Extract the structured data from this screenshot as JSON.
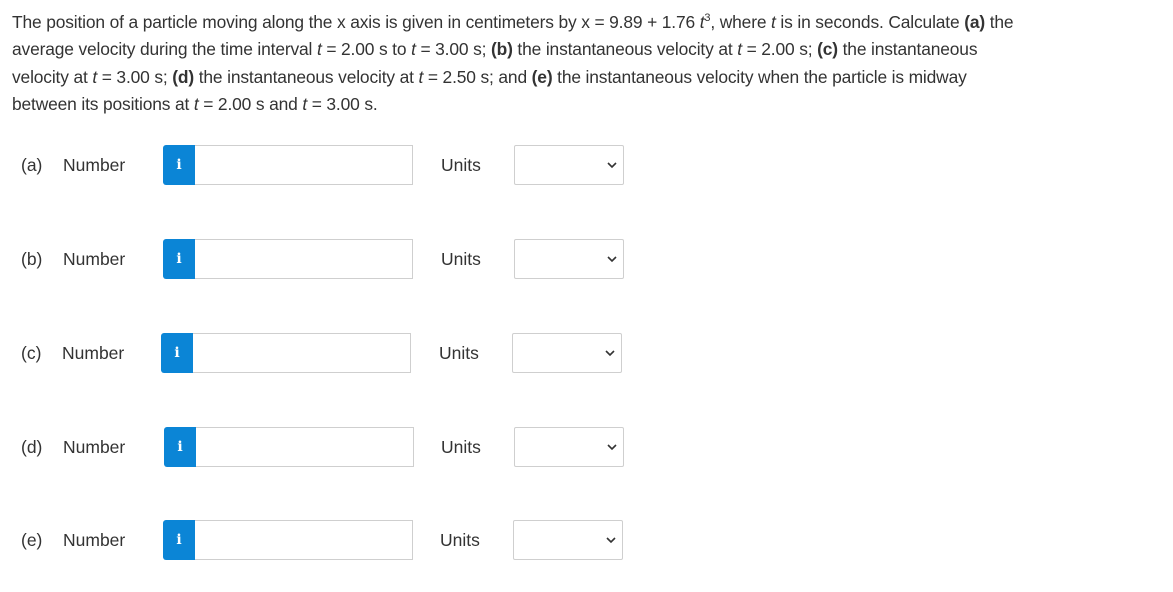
{
  "question": {
    "lines": [
      {
        "seg1": "The position of a particle moving along the x axis is given in centimeters by x = 9.89 + 1.76 ",
        "t": "t",
        "exp": "3",
        "seg2": ", where ",
        "t2": "t",
        "seg3": " is in seconds. Calculate ",
        "bold_a": "(a)",
        "seg4": " the"
      },
      {
        "seg1": "average velocity during the time interval ",
        "t1": "t",
        "seg2": " = 2.00 s to ",
        "t2": "t",
        "seg3": " = 3.00 s; ",
        "bold_b": "(b)",
        "seg4": " the instantaneous velocity at ",
        "t3": "t",
        "seg5": " = 2.00 s; ",
        "bold_c": "(c)",
        "seg6": " the instantaneous"
      },
      {
        "seg1": "velocity at ",
        "t1": "t",
        "seg2": " = 3.00 s; ",
        "bold_d": "(d)",
        "seg3": " the instantaneous velocity at ",
        "t2": "t",
        "seg4": " = 2.50 s; and ",
        "bold_e": "(e)",
        "seg5": " the instantaneous velocity when the particle is midway"
      },
      {
        "seg1": "between its positions at ",
        "t1": "t",
        "seg2": " = 2.00 s and ",
        "t2": "t",
        "seg3": " = 3.00 s."
      }
    ]
  },
  "parts": [
    {
      "letter": "(a)",
      "number_label": "Number",
      "info_icon": "i",
      "value": "",
      "units_label": "Units",
      "units_selected": ""
    },
    {
      "letter": "(b)",
      "number_label": "Number",
      "info_icon": "i",
      "value": "",
      "units_label": "Units",
      "units_selected": ""
    },
    {
      "letter": "(c)",
      "number_label": "Number",
      "info_icon": "i",
      "value": "",
      "units_label": "Units",
      "units_selected": ""
    },
    {
      "letter": "(d)",
      "number_label": "Number",
      "info_icon": "i",
      "value": "",
      "units_label": "Units",
      "units_selected": ""
    },
    {
      "letter": "(e)",
      "number_label": "Number",
      "info_icon": "i",
      "value": "",
      "units_label": "Units",
      "units_selected": ""
    }
  ],
  "colors": {
    "info_button": "#0b85d6",
    "text": "#333333",
    "border": "#cfcfcf"
  }
}
